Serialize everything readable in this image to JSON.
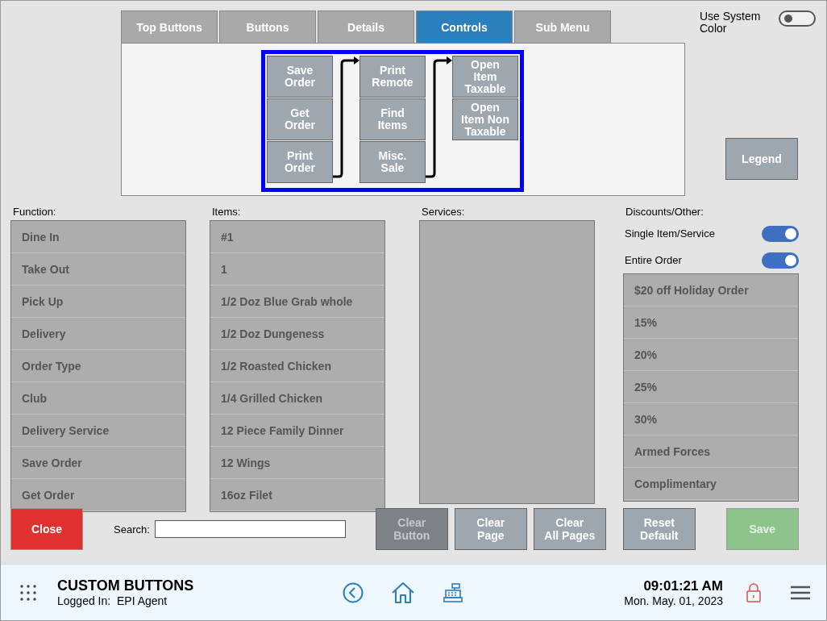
{
  "tabs": [
    {
      "label": "Top Buttons",
      "selected": false
    },
    {
      "label": "Buttons",
      "selected": false
    },
    {
      "label": "Details",
      "selected": false
    },
    {
      "label": "Controls",
      "selected": true
    },
    {
      "label": "Sub Menu",
      "selected": false
    }
  ],
  "use_system_color": {
    "label": "Use System Color",
    "on": false
  },
  "flow_columns": [
    {
      "buttons": [
        "Save\nOrder",
        "Get\nOrder",
        "Print\nOrder"
      ]
    },
    {
      "buttons": [
        "Print\nRemote",
        "Find\nItems",
        "Misc.\nSale"
      ]
    },
    {
      "buttons": [
        "Open\nItem\nTaxable",
        "Open\nItem Non\nTaxable"
      ]
    }
  ],
  "legend_button": "Legend",
  "lists": [
    {
      "kind": "list",
      "label": "Function:",
      "items": [
        "Dine In",
        "Take Out",
        "Pick Up",
        "Delivery",
        "Order Type",
        "Club",
        "Delivery Service",
        "Save Order",
        "Get Order"
      ]
    },
    {
      "kind": "list",
      "label": "Items:",
      "items": [
        "#1",
        "1",
        "1/2 Doz Blue Grab whole",
        "1/2 Doz Dungeness",
        "1/2 Roasted Chicken",
        "1/4 Grilled Chicken",
        "12 Piece Family Dinner",
        "12 Wings",
        "16oz Filet"
      ]
    },
    {
      "kind": "list",
      "label": "Services:"
    },
    {
      "kind": "discounts",
      "label": "Discounts/Other:",
      "toggles": [
        {
          "label": "Single Item/Service",
          "on": true
        },
        {
          "label": "Entire Order",
          "on": true
        }
      ],
      "items": [
        "$20 off Holiday Order",
        "15%",
        "20%",
        "25%",
        "30%",
        "Armed Forces",
        "Complimentary"
      ]
    }
  ],
  "close_button": "Close",
  "search": {
    "label": "Search:"
  },
  "action_buttons": [
    {
      "label": "Clear\nButton",
      "disabled": true
    },
    {
      "label": "Clear\nPage",
      "disabled": false
    },
    {
      "label": "Clear\nAll Pages",
      "disabled": false
    },
    {
      "label": "Reset\nDefault",
      "disabled": false
    }
  ],
  "save_button": {
    "label": "Save",
    "disabled": true
  },
  "footer": {
    "title": "CUSTOM BUTTONS",
    "logged_in": "Logged In:  EPI Agent",
    "time": "09:01:21 AM",
    "date": "Mon. May. 01, 2023"
  }
}
